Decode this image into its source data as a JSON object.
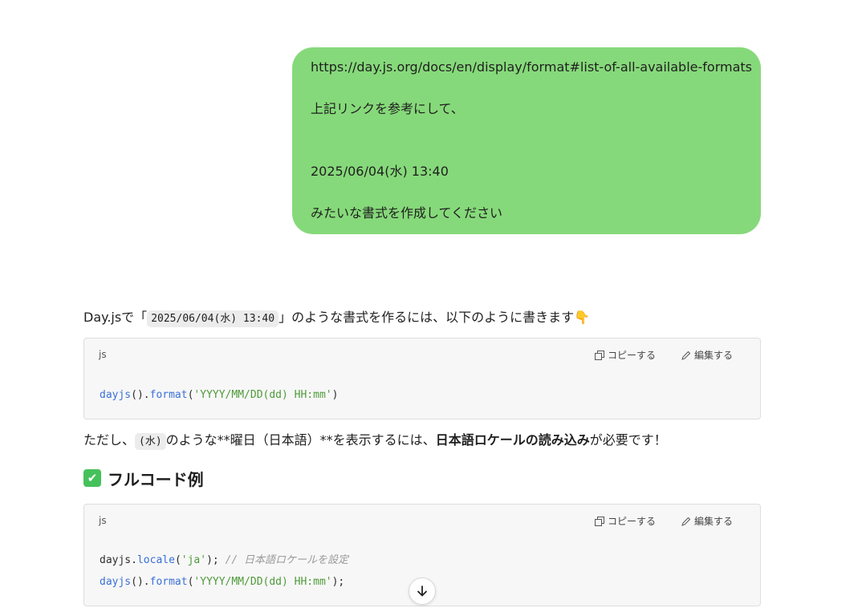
{
  "user_message": {
    "lines": [
      "https://day.js.org/docs/en/display/format#list-of-all-available-formats",
      "",
      "上記リンクを参考にして、",
      "",
      "",
      "2025/06/04(水) 13:40",
      "",
      "みたいな書式を作成してください"
    ],
    "bubble_color": "#86d97a"
  },
  "assistant": {
    "intro": {
      "prefix": "Day.jsで「",
      "code": "2025/06/04(水) 13:40",
      "suffix": "」のような書式を作るには、以下のように書きます",
      "emoji": "👇"
    },
    "code_block_1": {
      "lang": "js",
      "copy_label": "コピーする",
      "edit_label": "編集する",
      "line1": {
        "fn": "dayjs",
        "p1": "().",
        "method": "format",
        "p2": "(",
        "str": "'YYYY/MM/DD(dd) HH:mm'",
        "p3": ")"
      }
    },
    "note": {
      "prefix": "ただし、",
      "code": "(水)",
      "middle": "のような**曜日（日本語）**を表示するには、",
      "bold": "日本語ロケールの読み込み",
      "suffix": "が必要です！"
    },
    "section_heading": {
      "icon": "✔",
      "text": "フルコード例"
    },
    "code_block_2": {
      "lang": "js",
      "copy_label": "コピーする",
      "edit_label": "編集する",
      "line1": {
        "obj": "dayjs",
        "dot": ".",
        "method": "locale",
        "p1": "(",
        "str": "'ja'",
        "p2": "); ",
        "comment": "// 日本語ロケールを設定"
      },
      "line2": {
        "fn": "dayjs",
        "p1": "().",
        "method": "format",
        "p2": "(",
        "str": "'YYYY/MM/DD(dd) HH:mm'",
        "p3": ");"
      }
    }
  },
  "colors": {
    "accent_fn": "#3a6fd8",
    "string": "#4f9a3a",
    "comment": "#9a9a9a"
  }
}
